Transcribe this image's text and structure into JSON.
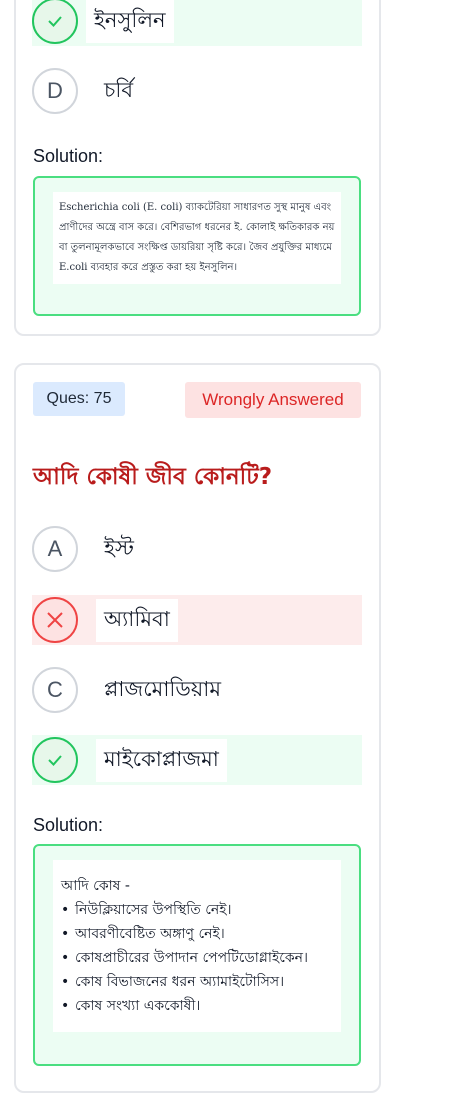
{
  "prev_question": {
    "option_d_correct": {
      "letter": "",
      "text": "ইনসুলিন"
    },
    "option_e": {
      "letter": "D",
      "text": "চর্বি"
    },
    "solution_title": "Solution:",
    "solution_text": "Escherichia coli (E. coli) ব্যাকটেরিয়া সাধারণত সুস্থ মানুষ এবং প্রাণীদের অন্ত্রে বাস করে। বেশিরভাগ ধরনের ই. কোলাই ক্ষতিকারক নয় বা তুলনামূলকভাবে সংক্ষিপ্ত ডায়রিয়া সৃষ্টি করে। জৈব প্রযুক্তির মাধ্যমে E.coli ব্যবহার করে প্রস্তুত করা হয় ইনসুলিন।"
  },
  "question": {
    "number_label": "Ques: 75",
    "status": "Wrongly Answered",
    "text": "আদি কোষী জীব কোনটি?",
    "options": [
      {
        "letter": "A",
        "text": "ইস্ট"
      },
      {
        "letter": "",
        "text": "অ্যামিবা"
      },
      {
        "letter": "C",
        "text": "প্লাজমোডিয়াম"
      },
      {
        "letter": "",
        "text": "মাইকোপ্লাজমা"
      }
    ],
    "solution_title": "Solution:",
    "solution_heading": "আদি কোষ -",
    "solution_points": [
      "নিউক্লিয়াসের উপস্থিতি নেই।",
      "আবরণীবেষ্টিত অঙ্গাণু নেই।",
      "কোষপ্রাচীরের উপাদান পেপটিডোগ্লাইকেন।",
      "কোষ বিভাজনের ধরন অ্যামাইটোসিস।",
      "কোষ সংখ্যা এককোষী।"
    ]
  },
  "colors": {
    "correct": "#22c55e",
    "wrong": "#ef4444",
    "accent": "#dc2626"
  }
}
